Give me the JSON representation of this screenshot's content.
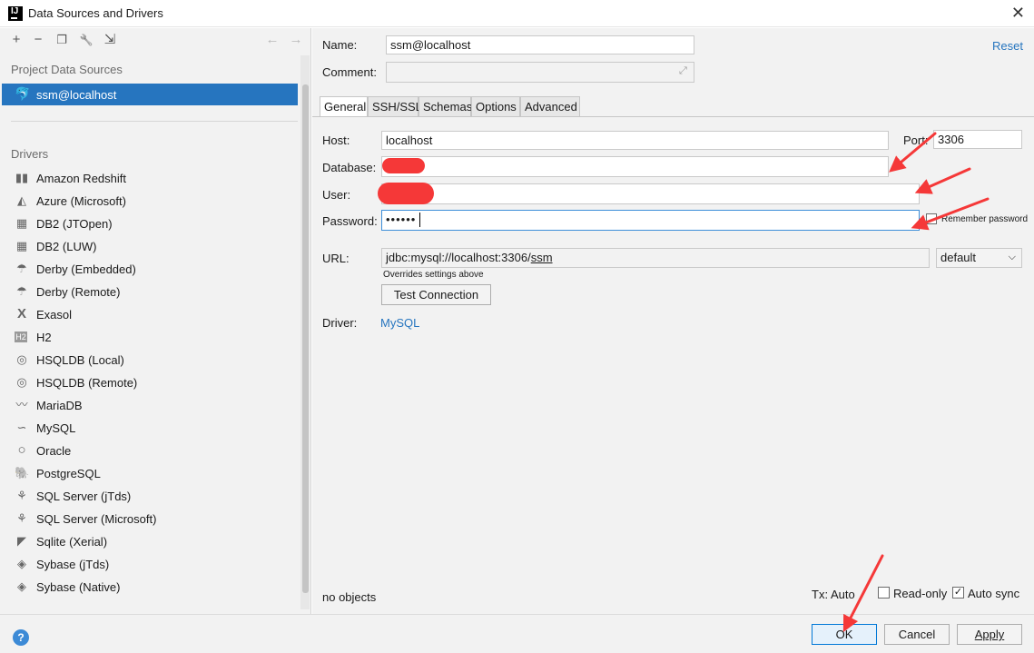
{
  "window": {
    "title": "Data Sources and Drivers",
    "close": "✕"
  },
  "left": {
    "toolbar": {
      "add": "+",
      "remove": "−",
      "copy": "❐",
      "settings": "🔧",
      "import": "⇲",
      "back": "←",
      "forward": "→"
    },
    "project_header": "Project Data Sources",
    "data_sources": [
      {
        "label": "ssm@localhost",
        "icon": "mysql-icon"
      }
    ],
    "drivers_header": "Drivers",
    "drivers": [
      {
        "label": "Amazon Redshift",
        "icon": "redshift-icon"
      },
      {
        "label": "Azure (Microsoft)",
        "icon": "azure-icon"
      },
      {
        "label": "DB2 (JTOpen)",
        "icon": "db2-icon"
      },
      {
        "label": "DB2 (LUW)",
        "icon": "db2-icon"
      },
      {
        "label": "Derby (Embedded)",
        "icon": "derby-icon"
      },
      {
        "label": "Derby (Remote)",
        "icon": "derby-icon"
      },
      {
        "label": "Exasol",
        "icon": "exasol-icon"
      },
      {
        "label": "H2",
        "icon": "h2-icon"
      },
      {
        "label": "HSQLDB (Local)",
        "icon": "hsqldb-icon"
      },
      {
        "label": "HSQLDB (Remote)",
        "icon": "hsqldb-icon"
      },
      {
        "label": "MariaDB",
        "icon": "mariadb-icon"
      },
      {
        "label": "MySQL",
        "icon": "mysql-icon"
      },
      {
        "label": "Oracle",
        "icon": "oracle-icon"
      },
      {
        "label": "PostgreSQL",
        "icon": "postgresql-icon"
      },
      {
        "label": "SQL Server (jTds)",
        "icon": "sqlserver-icon"
      },
      {
        "label": "SQL Server (Microsoft)",
        "icon": "sqlserver-icon"
      },
      {
        "label": "Sqlite (Xerial)",
        "icon": "sqlite-icon"
      },
      {
        "label": "Sybase (jTds)",
        "icon": "sybase-icon"
      },
      {
        "label": "Sybase (Native)",
        "icon": "sybase-icon"
      }
    ]
  },
  "form": {
    "name_label": "Name:",
    "name_value": "ssm@localhost",
    "comment_label": "Comment:",
    "comment_value": "",
    "reset": "Reset",
    "tabs": [
      "General",
      "SSH/SSL",
      "Schemas",
      "Options",
      "Advanced"
    ],
    "host_label": "Host:",
    "host_value": "localhost",
    "port_label": "Port:",
    "port_value": "3306",
    "database_label": "Database:",
    "database_value": "",
    "user_label": "User:",
    "user_value": "",
    "password_label": "Password:",
    "password_value": "••••••",
    "remember_password": "Remember password",
    "url_label": "URL:",
    "url_value_prefix": "jdbc:mysql://localhost:3306/",
    "url_value_db": "ssm",
    "url_hint": "Overrides settings above",
    "url_mode": "default",
    "test_connection": "Test Connection",
    "driver_label": "Driver:",
    "driver_value": "MySQL",
    "objects_status": "no objects",
    "tx_label": "Tx: Auto",
    "read_only": "Read-only",
    "auto_sync": "Auto sync"
  },
  "buttons": {
    "help": "?",
    "ok": "OK",
    "cancel": "Cancel",
    "apply": "Apply"
  },
  "annotation_color": "#f53838",
  "accent_color": "#2675bf"
}
